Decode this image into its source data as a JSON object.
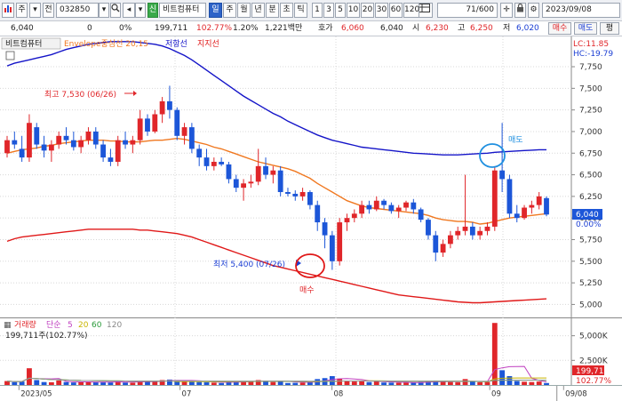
{
  "toolbar": {
    "code_prefix": "주",
    "code_mode": "전",
    "stock_code": "032850",
    "shin_badge": "신",
    "stock_name": "비트컴퓨터",
    "periods": [
      "일",
      "주",
      "월",
      "년",
      "분",
      "초",
      "틱"
    ],
    "selected_period": "일",
    "intervals": [
      "1",
      "3",
      "5",
      "10",
      "20",
      "30",
      "60",
      "120"
    ],
    "count": "71",
    "total": "/600",
    "date": "2023/09/08"
  },
  "infobar": {
    "price": "6,040",
    "change": "0",
    "change_pct": "0%",
    "volume": "199,711",
    "volume_ratio": "102.77%",
    "turnover_rate": "1.20%",
    "amount": "1,221백만",
    "ask_label": "호가",
    "ask": "6,060",
    "bid": "6,040",
    "open_label": "시",
    "open": "6,230",
    "high_label": "고",
    "high": "6,250",
    "low_label": "저",
    "low": "6,020",
    "buy_button": "매수",
    "sell_button": "매도",
    "eval_button": "평"
  },
  "main_legend": {
    "name": "비트컴퓨터",
    "envelope": "Envelope중심선 20,15",
    "resistance": "저항선",
    "support": "지지선"
  },
  "lc_label": "LC:11.85",
  "hc_label": "HC:-19.79",
  "current_price_tag": "6,040",
  "current_pct_tag": "0.00%",
  "annotations": {
    "high": "최고 7,530 (06/26)",
    "low": "최저 5,400 (07/26)",
    "buy": "매수",
    "sell": "매도"
  },
  "volume_legend": {
    "label": "거래량",
    "ma_label": "단순",
    "ma1": "5",
    "ma2": "20",
    "ma3": "60",
    "ma4": "120",
    "info": "199,711주(102.77%)"
  },
  "volume_tag": "199,711",
  "volume_pct_tag": "102.77%",
  "x_labels": [
    "2023/05",
    "07",
    "08",
    "09",
    "09/08"
  ],
  "colors": {
    "up": "#e0262a",
    "down": "#1c56d8",
    "upper_band": "#1414c8",
    "center": "#f07820",
    "lower_band": "#e01818",
    "accent": "#2d63c8"
  },
  "chart_data": {
    "type": "candlestick",
    "y_ticks": [
      7750,
      7500,
      7250,
      7000,
      6750,
      6500,
      6250,
      6000,
      5750,
      5500,
      5250,
      5000
    ],
    "y_range": [
      4850,
      8100
    ],
    "volume_ticks": [
      "5,000K",
      "2,500K"
    ],
    "volume_range": [
      0,
      6500
    ],
    "candles": [
      [
        6750,
        6950,
        6700,
        6900,
        400
      ],
      [
        6900,
        7000,
        6800,
        6850,
        300
      ],
      [
        6800,
        6950,
        6650,
        6700,
        350
      ],
      [
        6700,
        7200,
        6650,
        7100,
        1700
      ],
      [
        7050,
        7100,
        6800,
        6850,
        500
      ],
      [
        6850,
        6950,
        6700,
        6780,
        300
      ],
      [
        6780,
        6900,
        6650,
        6850,
        280
      ],
      [
        6850,
        7000,
        6800,
        6950,
        450
      ],
      [
        6950,
        7050,
        6850,
        6900,
        300
      ],
      [
        6900,
        7000,
        6780,
        6820,
        250
      ],
      [
        6820,
        6950,
        6750,
        6900,
        280
      ],
      [
        6900,
        7050,
        6850,
        7000,
        320
      ],
      [
        7000,
        7050,
        6800,
        6850,
        280
      ],
      [
        6850,
        6900,
        6650,
        6700,
        300
      ],
      [
        6700,
        6800,
        6600,
        6650,
        260
      ],
      [
        6650,
        6950,
        6600,
        6900,
        400
      ],
      [
        6900,
        7000,
        6800,
        6850,
        250
      ],
      [
        6850,
        6950,
        6750,
        6900,
        230
      ],
      [
        6900,
        7250,
        6850,
        7150,
        450
      ],
      [
        7150,
        7200,
        6950,
        7000,
        350
      ],
      [
        7000,
        7250,
        6980,
        7200,
        380
      ],
      [
        7200,
        7400,
        7100,
        7350,
        500
      ],
      [
        7350,
        7530,
        7150,
        7250,
        550
      ],
      [
        7250,
        7280,
        6900,
        6950,
        500
      ],
      [
        6950,
        7100,
        6850,
        7050,
        350
      ],
      [
        7050,
        7100,
        6750,
        6800,
        400
      ],
      [
        6800,
        6850,
        6600,
        6700,
        300
      ],
      [
        6700,
        6800,
        6550,
        6600,
        280
      ],
      [
        6600,
        6700,
        6550,
        6650,
        240
      ],
      [
        6650,
        6700,
        6600,
        6620,
        200
      ],
      [
        6620,
        6650,
        6400,
        6450,
        400
      ],
      [
        6450,
        6500,
        6300,
        6350,
        380
      ],
      [
        6350,
        6450,
        6200,
        6400,
        350
      ],
      [
        6400,
        6500,
        6350,
        6420,
        320
      ],
      [
        6420,
        6800,
        6380,
        6600,
        500
      ],
      [
        6600,
        6700,
        6450,
        6500,
        450
      ],
      [
        6500,
        6600,
        6400,
        6550,
        300
      ],
      [
        6550,
        6600,
        6250,
        6300,
        420
      ],
      [
        6300,
        6350,
        6250,
        6280,
        200
      ],
      [
        6280,
        6320,
        6200,
        6250,
        220
      ],
      [
        6250,
        6350,
        6200,
        6300,
        240
      ],
      [
        6300,
        6320,
        6100,
        6150,
        300
      ],
      [
        6150,
        6200,
        5850,
        5950,
        600
      ],
      [
        5950,
        6000,
        5650,
        5800,
        700
      ],
      [
        5800,
        5850,
        5400,
        5500,
        900
      ],
      [
        5500,
        6000,
        5450,
        5950,
        650
      ],
      [
        5950,
        6050,
        5850,
        6000,
        450
      ],
      [
        6000,
        6100,
        5950,
        6050,
        350
      ],
      [
        6050,
        6200,
        6000,
        6150,
        420
      ],
      [
        6150,
        6200,
        6050,
        6100,
        300
      ],
      [
        6100,
        6250,
        6080,
        6200,
        380
      ],
      [
        6200,
        6220,
        6100,
        6150,
        250
      ],
      [
        6150,
        6180,
        6050,
        6080,
        240
      ],
      [
        6080,
        6150,
        6000,
        6120,
        230
      ],
      [
        6120,
        6200,
        6080,
        6180,
        260
      ],
      [
        6180,
        6220,
        6050,
        6100,
        240
      ],
      [
        6100,
        6120,
        5950,
        5980,
        300
      ],
      [
        5980,
        6000,
        5750,
        5800,
        380
      ],
      [
        5800,
        5850,
        5500,
        5600,
        450
      ],
      [
        5600,
        5750,
        5550,
        5700,
        330
      ],
      [
        5700,
        5850,
        5650,
        5800,
        300
      ],
      [
        5800,
        5900,
        5750,
        5850,
        280
      ],
      [
        5850,
        6500,
        5800,
        5900,
        600
      ],
      [
        5900,
        5950,
        5750,
        5800,
        320
      ],
      [
        5800,
        5900,
        5750,
        5850,
        280
      ],
      [
        5850,
        5950,
        5800,
        5900,
        300
      ],
      [
        5900,
        6600,
        5850,
        6550,
        6300
      ],
      [
        6550,
        7100,
        6300,
        6450,
        1500
      ],
      [
        6450,
        6500,
        6000,
        6050,
        900
      ],
      [
        6050,
        6150,
        5950,
        6000,
        400
      ],
      [
        6000,
        6150,
        5980,
        6120,
        330
      ],
      [
        6120,
        6200,
        6050,
        6150,
        300
      ],
      [
        6150,
        6300,
        6100,
        6250,
        350
      ],
      [
        6230,
        6250,
        6020,
        6040,
        199.711
      ]
    ],
    "ma": {
      "center": [
        6750,
        6770,
        6790,
        6800,
        6810,
        6830,
        6840,
        6860,
        6870,
        6880,
        6890,
        6900,
        6900,
        6900,
        6890,
        6890,
        6880,
        6880,
        6880,
        6890,
        6900,
        6900,
        6910,
        6920,
        6910,
        6890,
        6870,
        6850,
        6820,
        6800,
        6770,
        6740,
        6710,
        6680,
        6650,
        6630,
        6610,
        6590,
        6570,
        6540,
        6500,
        6460,
        6400,
        6350,
        6300,
        6250,
        6200,
        6170,
        6140,
        6120,
        6110,
        6100,
        6090,
        6080,
        6070,
        6060,
        6050,
        6030,
        6000,
        5980,
        5970,
        5960,
        5960,
        5950,
        5930,
        5940,
        5960,
        5980,
        6000,
        6010,
        6020,
        6030,
        6040,
        6050
      ],
      "upper": [
        7760,
        7790,
        7810,
        7830,
        7850,
        7870,
        7890,
        7920,
        7950,
        7970,
        7990,
        8010,
        8020,
        8030,
        8040,
        8040,
        8040,
        8040,
        8030,
        8020,
        8010,
        7990,
        7960,
        7920,
        7880,
        7830,
        7770,
        7710,
        7650,
        7590,
        7530,
        7470,
        7410,
        7360,
        7310,
        7260,
        7210,
        7170,
        7120,
        7080,
        7040,
        7000,
        6960,
        6930,
        6900,
        6880,
        6860,
        6840,
        6820,
        6810,
        6800,
        6790,
        6780,
        6770,
        6760,
        6750,
        6745,
        6740,
        6735,
        6730,
        6730,
        6730,
        6735,
        6740,
        6745,
        6750,
        6760,
        6765,
        6770,
        6775,
        6780,
        6785,
        6790,
        6790
      ],
      "lower": [
        5730,
        5760,
        5780,
        5790,
        5800,
        5810,
        5820,
        5830,
        5840,
        5850,
        5860,
        5870,
        5870,
        5870,
        5870,
        5870,
        5870,
        5870,
        5860,
        5860,
        5850,
        5840,
        5830,
        5820,
        5800,
        5780,
        5750,
        5720,
        5690,
        5660,
        5630,
        5600,
        5570,
        5540,
        5510,
        5480,
        5450,
        5430,
        5410,
        5390,
        5370,
        5350,
        5330,
        5310,
        5290,
        5270,
        5250,
        5230,
        5210,
        5190,
        5170,
        5150,
        5130,
        5110,
        5100,
        5090,
        5080,
        5070,
        5060,
        5050,
        5040,
        5030,
        5025,
        5020,
        5020,
        5025,
        5030,
        5035,
        5040,
        5045,
        5050,
        5055,
        5060,
        5065
      ]
    }
  }
}
